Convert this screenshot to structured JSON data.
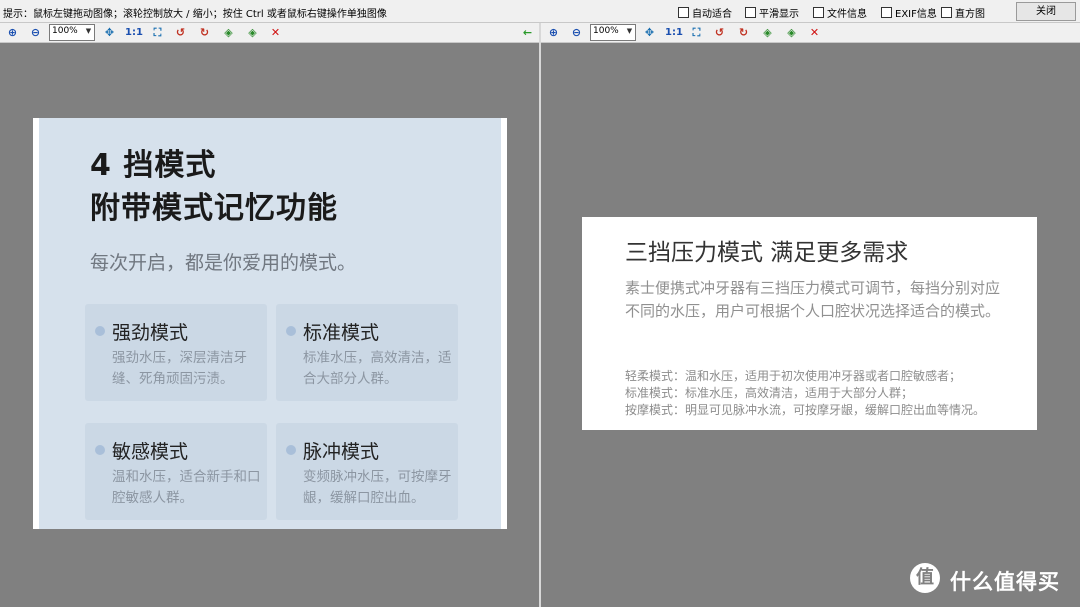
{
  "topbar": {
    "hint": "提示：鼠标左键拖动图像；滚轮控制放大 / 缩小；按住 Ctrl 或者鼠标右键操作单独图像",
    "options": [
      {
        "label": "自动适合",
        "checked": false
      },
      {
        "label": "平滑显示",
        "checked": false
      },
      {
        "label": "文件信息",
        "checked": false
      },
      {
        "label": "EXIF信息",
        "checked": false
      },
      {
        "label": "直方图",
        "checked": false
      }
    ],
    "close_label": "关闭"
  },
  "toolbar": {
    "zoom_left": "100%",
    "zoom_right": "100%",
    "one_to_one": "1:1",
    "icons": [
      "zoom-in-icon",
      "zoom-out-icon",
      "fit-icon",
      "one-to-one-icon",
      "fullscreen-icon",
      "rotate-left-icon",
      "rotate-right-icon",
      "prev-icon",
      "next-icon",
      "delete-icon",
      "sync-arrow-icon"
    ]
  },
  "left_image": {
    "title_line1": "4 挡模式",
    "title_line2": "附带模式记忆功能",
    "subtitle": "每次开启，都是你爱用的模式。",
    "cards": [
      {
        "title": "强劲模式",
        "desc": "强劲水压，深层清洁牙缝、死角顽固污渍。"
      },
      {
        "title": "标准模式",
        "desc": "标准水压，高效清洁，适合大部分人群。"
      },
      {
        "title": "敏感模式",
        "desc": "温和水压，适合新手和口腔敏感人群。"
      },
      {
        "title": "脉冲模式",
        "desc": "变频脉冲水压，可按摩牙龈，缓解口腔出血。"
      }
    ]
  },
  "right_image": {
    "title": "三挡压力模式 满足更多需求",
    "paragraph": "素士便携式冲牙器有三挡压力模式可调节，每挡分别对应不同的水压，用户可根据个人口腔状况选择适合的模式。",
    "lines": [
      "轻柔模式：温和水压，适用于初次使用冲牙器或者口腔敏感者；",
      "标准模式：标准水压，高效清洁，适用于大部分人群；",
      "按摩模式：明显可见脉冲水流，可按摩牙龈，缓解口腔出血等情况。"
    ]
  },
  "watermark": {
    "logo_char": "值",
    "text": "什么值得买"
  }
}
